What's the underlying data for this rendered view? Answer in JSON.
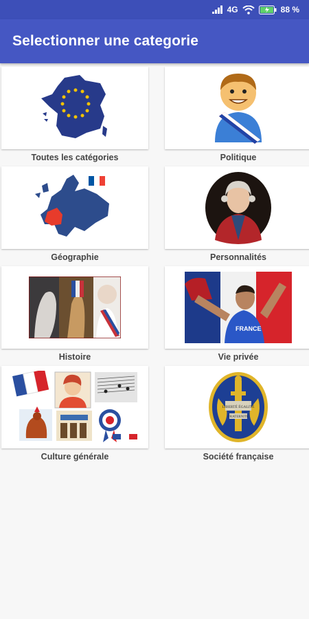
{
  "status": {
    "network": "4G",
    "battery": "88 %"
  },
  "app_bar": {
    "title": "Selectionner une categorie"
  },
  "categories": [
    {
      "label": "Toutes les catégories",
      "icon": "france-eu-map-icon"
    },
    {
      "label": "Politique",
      "icon": "politician-sash-icon"
    },
    {
      "label": "Géographie",
      "icon": "europe-map-icon"
    },
    {
      "label": "Personnalités",
      "icon": "royal-portrait-icon"
    },
    {
      "label": "Histoire",
      "icon": "history-collage-icon"
    },
    {
      "label": "Vie privée",
      "icon": "fan-with-flag-icon"
    },
    {
      "label": "Culture générale",
      "icon": "culture-collage-icon"
    },
    {
      "label": "Société française",
      "icon": "french-emblem-icon"
    }
  ]
}
